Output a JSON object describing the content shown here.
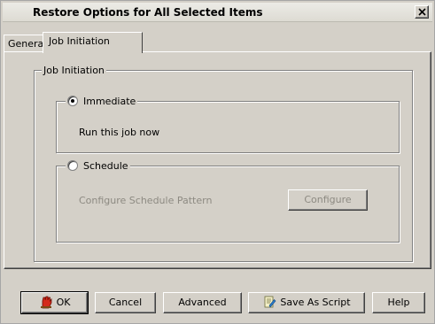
{
  "window": {
    "title": "Restore Options for All Selected Items",
    "close_glyph": "✕"
  },
  "tabs": [
    {
      "label": "General",
      "active": false
    },
    {
      "label": "Job Initiation",
      "active": true
    }
  ],
  "job_initiation": {
    "group_label": "Job Initiation",
    "immediate": {
      "label": "Immediate",
      "checked": true,
      "description": "Run this job now"
    },
    "schedule": {
      "label": "Schedule",
      "checked": false,
      "pattern_label": "Configure Schedule Pattern",
      "configure_button": "Configure",
      "enabled": false
    }
  },
  "buttons": {
    "ok": "OK",
    "ok_icon": "stop-sign-hand-icon",
    "cancel": "Cancel",
    "advanced": "Advanced",
    "save_script": "Save As Script",
    "save_script_icon": "script-icon",
    "help": "Help"
  },
  "colors": {
    "dialog_bg": "#d4d0c8",
    "disabled_text": "#8d8a82"
  }
}
